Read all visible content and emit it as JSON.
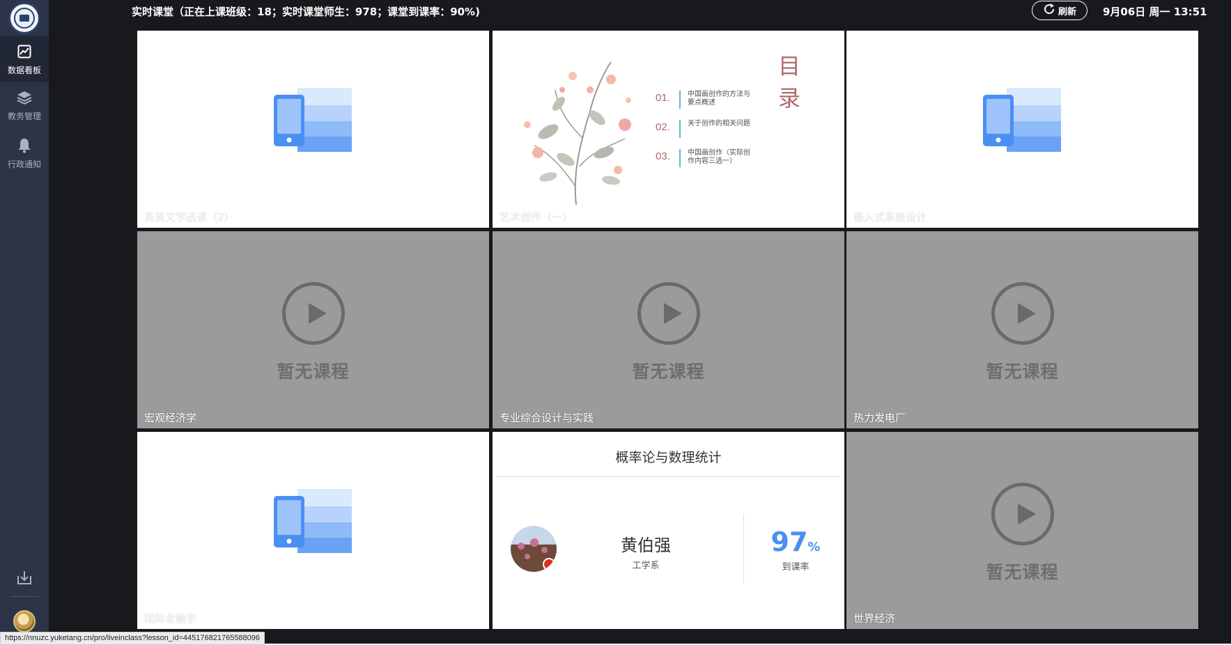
{
  "header": {
    "title": "实时课堂（正在上课班级：18；实时课堂师生：978；课堂到课率：90%)",
    "refresh_label": "刷新",
    "datetime": "9月06日 周一 13:51"
  },
  "sidebar": {
    "logo_icon": "university-seal-icon",
    "items": [
      {
        "label": "数据看板",
        "icon": "chart-line-icon",
        "active": true
      },
      {
        "label": "教务管理",
        "icon": "layers-icon",
        "active": false
      },
      {
        "label": "行政通知",
        "icon": "bell-icon",
        "active": false
      }
    ],
    "download_icon": "download-icon"
  },
  "tiles": [
    {
      "caption": "英美文学选读（2）",
      "type": "document"
    },
    {
      "caption": "艺术创作（一）",
      "type": "slide"
    },
    {
      "caption": "嵌入式系统设计",
      "type": "document"
    },
    {
      "caption": "宏观经济学",
      "type": "empty"
    },
    {
      "caption": "专业综合设计与实践",
      "type": "empty"
    },
    {
      "caption": "热力发电厂",
      "type": "empty"
    },
    {
      "caption": "国际金融学",
      "type": "document"
    },
    {
      "caption": "",
      "type": "teacher-card"
    },
    {
      "caption": "世界经济",
      "type": "empty"
    }
  ],
  "empty_text": "暂无课程",
  "slide": {
    "title": "目 录",
    "items": [
      {
        "num": "01.",
        "text": "中国画创作的方法与要点概述"
      },
      {
        "num": "02.",
        "text": "关于创作的相关问题"
      },
      {
        "num": "03.",
        "text": "中国画创作（实际创作内容三选一）"
      }
    ]
  },
  "teacher_card": {
    "course": "概率论与数理统计",
    "teacher": "黄伯强",
    "department": "工学系",
    "rate": "97",
    "rate_unit": "%",
    "rate_label": "到课率"
  },
  "status_bar": {
    "url": "https://nnuzc.yuketang.cn/pro/liveinclass?lesson_id=445176821765588096"
  },
  "colors": {
    "background": "#18191d",
    "sidebar": "#2d3448",
    "empty_tile": "#9b9b9b",
    "accent_blue": "#4a8ff2"
  }
}
